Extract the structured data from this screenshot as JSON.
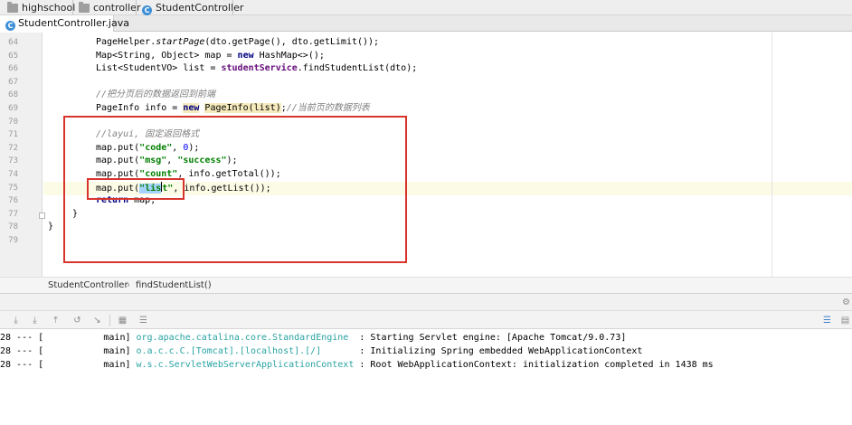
{
  "breadcrumb": {
    "items": [
      {
        "label": "highschool",
        "icon": "folder-icon"
      },
      {
        "label": "controller",
        "icon": "folder-icon"
      },
      {
        "label": "StudentController",
        "icon": "class-icon"
      }
    ]
  },
  "tabs": [
    {
      "label": "StudentController.java",
      "icon": "class-icon",
      "active": true
    }
  ],
  "editor": {
    "line_numbers": [
      "64",
      "65",
      "66",
      "67",
      "68",
      "69",
      "70",
      "71",
      "72",
      "73",
      "74",
      "75",
      "76",
      "77",
      "78",
      "79"
    ],
    "current_line": "75",
    "lines": {
      "l64": {
        "a": "PageHelper.",
        "b": "startPage",
        "c": "(dto.getPage(), dto.getLimit());"
      },
      "l65": {
        "a": "Map<String, Object> map = ",
        "kw": "new",
        "b": " HashMap<>();"
      },
      "l66": {
        "a": "List<StudentVO> list = ",
        "fld": "studentService",
        "b": ".findStudentList(dto);"
      },
      "l68": {
        "cm": "//把分页后的数据返回到前端"
      },
      "l69": {
        "a": "PageInfo info = ",
        "kw": "new",
        "hl": "PageInfo(list)",
        "b": ";",
        "cm": "//当前页的数据列表"
      },
      "l71": {
        "cm": "//layui, 固定返回格式"
      },
      "l72": {
        "a": "map.put(",
        "s1": "\"code\"",
        "b": ", ",
        "num": "0",
        "c": ");"
      },
      "l73": {
        "a": "map.put(",
        "s1": "\"msg\"",
        "b": ", ",
        "s2": "\"success\"",
        "c": ");"
      },
      "l74": {
        "a": "map.put(",
        "s1": "\"count\"",
        "b": ", info.getTotal());"
      },
      "l75": {
        "a": "map.put(",
        "s1a": "\"lis",
        "s1b": "t\"",
        "b": ", info.getList());"
      },
      "l76": {
        "kw": "return",
        "b": " map;"
      },
      "l77": {
        "a": "}"
      },
      "l78": {
        "a": "}"
      }
    }
  },
  "editor_footer": {
    "items": [
      "StudentController",
      "findStudentList()"
    ],
    "separator": "›"
  },
  "console": {
    "lines": [
      {
        "pre": "28 --- [           main] ",
        "logger": "org.apache.catalina.core.StandardEngine  ",
        "msg": ": Starting Servlet engine: [Apache Tomcat/9.0.73]"
      },
      {
        "pre": "28 --- [           main] ",
        "logger": "o.a.c.c.C.[Tomcat].[localhost].[/]       ",
        "msg": ": Initializing Spring embedded WebApplicationContext"
      },
      {
        "pre": "28 --- [           main] ",
        "logger": "w.s.c.ServletWebServerApplicationContext ",
        "msg": ": Root WebApplicationContext: initialization completed in 1438 ms"
      }
    ]
  },
  "colors": {
    "annotation": "#d9342b",
    "keyword": "#000080",
    "string": "#008000",
    "comment": "#808080",
    "logger": "#2aa3a3"
  }
}
